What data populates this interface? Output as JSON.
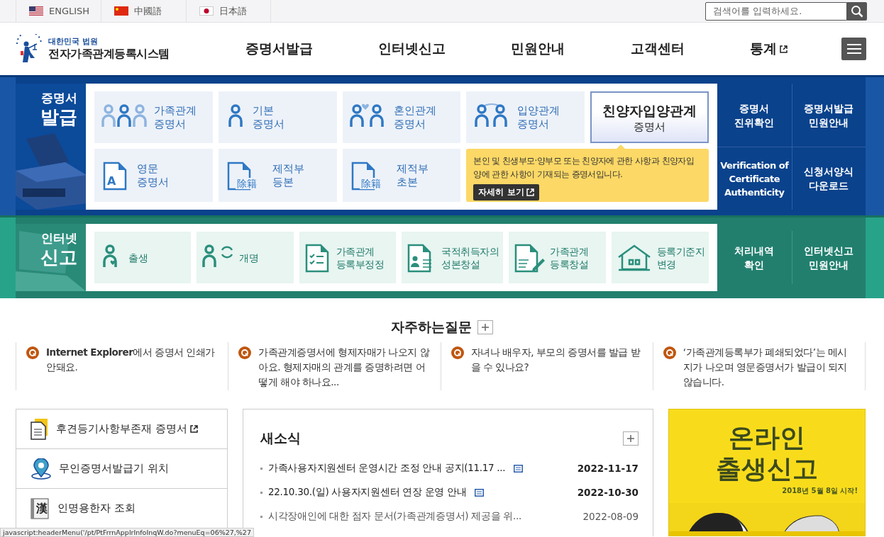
{
  "languages": [
    {
      "label": "ENGLISH",
      "kind": "us"
    },
    {
      "label": "中國語",
      "kind": "cn"
    },
    {
      "label": "日本語",
      "kind": "jp"
    }
  ],
  "search": {
    "placeholder": "검색어를 입력하세요."
  },
  "logo": {
    "subtitle": "대한민국 법원",
    "title": "전자가족관계등록시스템"
  },
  "nav": [
    {
      "label": "증명서발급",
      "external": false
    },
    {
      "label": "인터넷신고",
      "external": false
    },
    {
      "label": "민원안내",
      "external": false
    },
    {
      "label": "고객센터",
      "external": false
    },
    {
      "label": "통계",
      "external": true
    }
  ],
  "certificates": {
    "heading": [
      "증명서",
      "발급"
    ],
    "tiles": [
      {
        "lines": [
          "가족관계",
          "증명서"
        ],
        "kind": "family",
        "selected": false
      },
      {
        "lines": [
          "기본",
          "증명서"
        ],
        "kind": "person",
        "selected": false
      },
      {
        "lines": [
          "혼인관계",
          "증명서"
        ],
        "kind": "couple",
        "selected": false
      },
      {
        "lines": [
          "입양관계",
          "증명서"
        ],
        "kind": "adopt",
        "selected": false
      },
      {
        "lines": [
          "친양자입양관계",
          "증명서"
        ],
        "selected": true
      },
      {
        "lines": [
          "영문",
          "증명서"
        ],
        "kind": "english",
        "letter": "A",
        "selected": false
      },
      {
        "lines": [
          "제적부",
          "등본"
        ],
        "kind": "seal",
        "seal": "除籍",
        "selected": false
      },
      {
        "lines": [
          "제적부",
          "초본"
        ],
        "kind": "seal",
        "seal": "除籍",
        "selected": false
      }
    ],
    "tooltip": {
      "text": "본인 및 친생부모·양부모 또는 친양자에 관한 사항과 친양자입양에 관한 사항이 기재되는 증명서입니다.",
      "button": "자세히 보기"
    },
    "links": [
      [
        "증명서",
        "진위확인"
      ],
      [
        "증명서발급",
        "민원안내"
      ],
      [
        "Verification of",
        "Certificate",
        "Authenticity"
      ],
      [
        "신청서양식",
        "다운로드"
      ]
    ]
  },
  "filing": {
    "heading": [
      "인터넷",
      "신고"
    ],
    "tiles": [
      {
        "lines": [
          "출생"
        ],
        "kind": "birth"
      },
      {
        "lines": [
          "개명"
        ],
        "kind": "rename"
      },
      {
        "lines": [
          "가족관계",
          "등록부정정"
        ],
        "kind": "checklist"
      },
      {
        "lines": [
          "국적취득자의",
          "성본창설"
        ],
        "kind": "docperson"
      },
      {
        "lines": [
          "가족관계",
          "등록창설"
        ],
        "kind": "docpen"
      },
      {
        "lines": [
          "등록기준지",
          "변경"
        ],
        "kind": "house"
      }
    ],
    "links": [
      [
        "처리내역",
        "확인"
      ],
      [
        "인터넷신고",
        "민원안내"
      ]
    ]
  },
  "faq": {
    "title": "자주하는질문",
    "items": [
      "**Internet Explorer**에서 증명서 인쇄가 안돼요.",
      "가족관계증명서에 형제자매가 나오지 않아요. 형제자매의 관계를 증명하려면 어떻게 해야 하나요...",
      "자녀나 배우자, 부모의 증명서를 발급 받을 수 있나요?",
      "‘가족관계등록부가 폐쇄되었다’는 메시지가 나오며 영문증명서가 발급이 되지 않습니다."
    ]
  },
  "quick_links": [
    {
      "label": "후견등기사항부존재 증명서",
      "kind": "document",
      "external": true
    },
    {
      "label": "무인증명서발급기 위치",
      "kind": "pin",
      "external": false
    },
    {
      "label": "인명용한자 조회",
      "kind": "book",
      "glyph": "漢",
      "external": false
    }
  ],
  "news": {
    "title": "새소식",
    "items": [
      {
        "title": "가족사용자지원센터 운영시간 조정 안내 공지(11.17 ...",
        "date": "2022-11-17",
        "bold": true,
        "memo": true
      },
      {
        "title": "22.10.30.(일) 사용자지원센터 연장 운영 안내",
        "date": "2022-10-30",
        "bold": true,
        "memo": true
      },
      {
        "title": "시각장애인에 대한 점자 문서(가족관계증명서) 제공을 위...",
        "date": "2022-08-09",
        "bold": false,
        "memo": false
      }
    ]
  },
  "banner": {
    "lines": [
      "온라인",
      "출생신고"
    ],
    "caption": "2018년 5월 8일 시작!"
  },
  "status_bar": "javascript:headerMenu('/pt/PtFrrnApplrInfoInqW.do?menuEq=06%27,%27"
}
